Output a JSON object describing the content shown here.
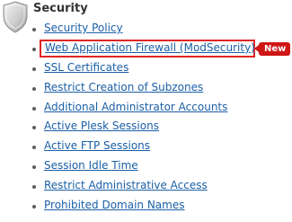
{
  "section": {
    "title": "Security",
    "icon": "shield-icon"
  },
  "links": [
    {
      "label": "Security Policy"
    },
    {
      "label": "Web Application Firewall (ModSecurity)",
      "badge": "New"
    },
    {
      "label": "SSL Certificates"
    },
    {
      "label": "Restrict Creation of Subzones"
    },
    {
      "label": "Additional Administrator Accounts"
    },
    {
      "label": "Active Plesk Sessions"
    },
    {
      "label": "Active FTP Sessions"
    },
    {
      "label": "Session Idle Time"
    },
    {
      "label": "Restrict Administrative Access"
    },
    {
      "label": "Prohibited Domain Names"
    }
  ],
  "colors": {
    "link": "#1a5fa6",
    "highlight_border": "#e02525",
    "badge_bg": "#cf1515"
  }
}
